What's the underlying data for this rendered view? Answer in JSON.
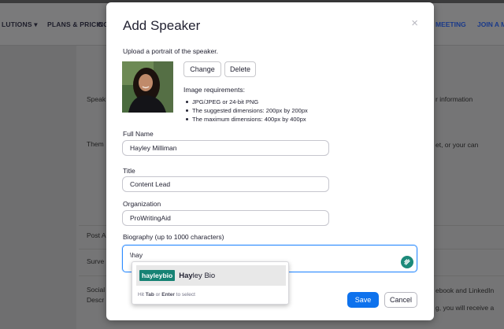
{
  "background": {
    "nav": {
      "solutions": "LUTIONS",
      "plans": "PLANS & PRICING",
      "truncated": "C",
      "meeting": "MEETING",
      "join": "JOIN A M"
    },
    "labels": {
      "speak": "Speak",
      "theme": "Them",
      "post": "Post A",
      "survey": "Surve",
      "social": "Social",
      "descr": "Descr"
    },
    "right_text": {
      "information": "r information",
      "set_or": "et, or your can",
      "ebook": "ebook and LinkedIn",
      "receive": "g, you will receive a"
    }
  },
  "modal": {
    "title": "Add Speaker",
    "close_glyph": "×",
    "upload_hint": "Upload a portrait of the speaker.",
    "change_label": "Change",
    "delete_label": "Delete",
    "requirements_title": "Image requirements:",
    "requirements": [
      "JPG/JPEG or 24-bit PNG",
      "The suggested dimensions: 200px by 200px",
      "The maximum dimensions: 400px by 400px"
    ],
    "full_name": {
      "label": "Full Name",
      "value": "Hayley Milliman"
    },
    "title_field": {
      "label": "Title",
      "value": "Content Lead"
    },
    "organization": {
      "label": "Organization",
      "value": "ProWritingAid"
    },
    "biography": {
      "label": "Biography (up to 1000 characters)",
      "value": "\\hay"
    },
    "save_label": "Save",
    "cancel_label": "Cancel"
  },
  "autocomplete": {
    "keyword": "hayleybio",
    "match_bold": "Hay",
    "match_rest": "ley Bio",
    "hint_prefix": "Hit ",
    "hint_key1": "Tab",
    "hint_mid": " or ",
    "hint_key2": "Enter",
    "hint_suffix": " to select"
  },
  "icons": {
    "close": "close-icon",
    "bio_extension": "text-expander-icon",
    "portrait": "speaker-portrait"
  },
  "colors": {
    "primary": "#0e72ed",
    "focus": "#2d8cff",
    "snippet": "#168274",
    "overlay": "#6f6f70"
  }
}
